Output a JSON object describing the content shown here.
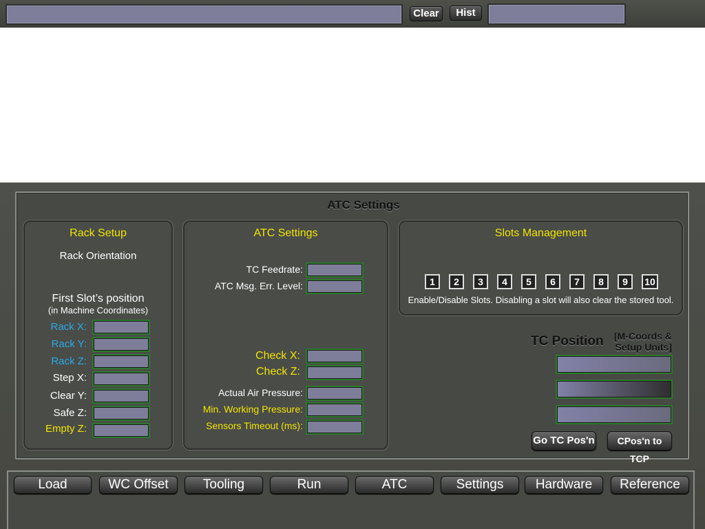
{
  "topbar": {
    "clear_label": "Clear",
    "hist_label": "Hist"
  },
  "main": {
    "title": "ATC Settings"
  },
  "rack_setup": {
    "title": "Rack Setup",
    "orientation_label": "Rack Orientation",
    "first_slot_label": "First Slot’s position",
    "first_slot_sub": "(in Machine Coordinates)",
    "fields": [
      {
        "label": "Rack X:",
        "value": ""
      },
      {
        "label": "Rack Y:",
        "value": ""
      },
      {
        "label": "Rack Z:",
        "value": ""
      },
      {
        "label": "Step X:",
        "value": ""
      },
      {
        "label": "Clear Y:",
        "value": ""
      },
      {
        "label": "Safe Z:",
        "value": ""
      },
      {
        "label": "Empty Z:",
        "value": ""
      }
    ]
  },
  "atc_settings": {
    "title": "ATC Settings",
    "tc_feedrate_label": "TC Feedrate:",
    "atc_msg_label": "ATC Msg. Err. Level:",
    "check_x_label": "Check X:",
    "check_z_label": "Check Z:",
    "air_pressure_label": "Actual Air Pressure:",
    "min_pressure_label": "Min. Working Pressure:",
    "sensors_timeout_label": "Sensors Timeout (ms):"
  },
  "slots": {
    "title": "Slots Management",
    "items": [
      "1",
      "2",
      "3",
      "4",
      "5",
      "6",
      "7",
      "8",
      "9",
      "10"
    ],
    "description": "Enable/Disable Slots. Disabling a slot will also clear the stored tool."
  },
  "tc_position": {
    "title": "TC Position",
    "note_line1": "[M-Coords &",
    "note_line2": "Setup Units]",
    "go_button": "Go TC Pos'n",
    "cpos_button": "CPos'n to TCP"
  },
  "nav": {
    "items": [
      "Load",
      "WC Offset",
      "Tooling",
      "Run",
      "ATC",
      "Settings",
      "Hardware",
      "Reference"
    ]
  },
  "colors": {
    "accent_yellow": "#f2e600",
    "accent_blue": "#2aa9e6",
    "field_fill": "#7e7e9a",
    "field_border": "#2c7a2c"
  }
}
